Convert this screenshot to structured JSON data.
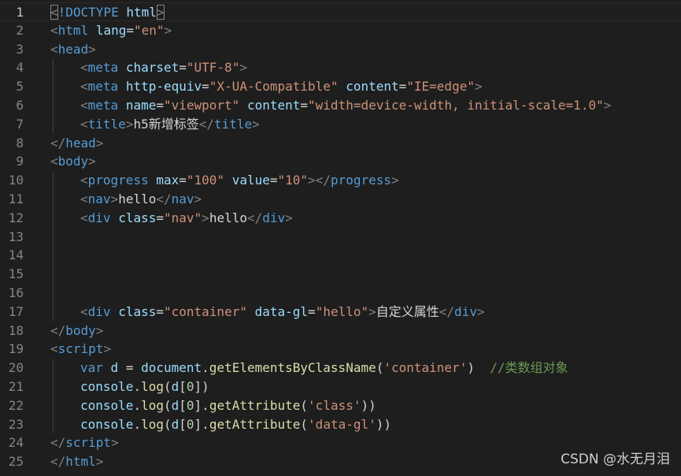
{
  "editor": {
    "lines": [
      {
        "num": "1",
        "indent": 0,
        "tokens": [
          {
            "t": "<",
            "c": "bracket",
            "m": 1
          },
          {
            "t": "!DOCTYPE",
            "c": "tag"
          },
          {
            "t": " ",
            "c": "text"
          },
          {
            "t": "html",
            "c": "attr"
          },
          {
            "t": ">",
            "c": "bracket",
            "m": 1
          }
        ]
      },
      {
        "num": "2",
        "indent": 0,
        "tokens": [
          {
            "t": "<",
            "c": "bracket"
          },
          {
            "t": "html",
            "c": "tag"
          },
          {
            "t": " ",
            "c": "text"
          },
          {
            "t": "lang",
            "c": "attr"
          },
          {
            "t": "=",
            "c": "punct"
          },
          {
            "t": "\"en\"",
            "c": "str"
          },
          {
            "t": ">",
            "c": "bracket"
          }
        ]
      },
      {
        "num": "3",
        "indent": 0,
        "tokens": [
          {
            "t": "<",
            "c": "bracket"
          },
          {
            "t": "head",
            "c": "tag"
          },
          {
            "t": ">",
            "c": "bracket"
          }
        ]
      },
      {
        "num": "4",
        "indent": 1,
        "tokens": [
          {
            "t": "<",
            "c": "bracket"
          },
          {
            "t": "meta",
            "c": "tag"
          },
          {
            "t": " ",
            "c": "text"
          },
          {
            "t": "charset",
            "c": "attr"
          },
          {
            "t": "=",
            "c": "punct"
          },
          {
            "t": "\"UTF-8\"",
            "c": "str"
          },
          {
            "t": ">",
            "c": "bracket"
          }
        ]
      },
      {
        "num": "5",
        "indent": 1,
        "tokens": [
          {
            "t": "<",
            "c": "bracket"
          },
          {
            "t": "meta",
            "c": "tag"
          },
          {
            "t": " ",
            "c": "text"
          },
          {
            "t": "http-equiv",
            "c": "attr"
          },
          {
            "t": "=",
            "c": "punct"
          },
          {
            "t": "\"X-UA-Compatible\"",
            "c": "str"
          },
          {
            "t": " ",
            "c": "text"
          },
          {
            "t": "content",
            "c": "attr"
          },
          {
            "t": "=",
            "c": "punct"
          },
          {
            "t": "\"IE=edge\"",
            "c": "str"
          },
          {
            "t": ">",
            "c": "bracket"
          }
        ]
      },
      {
        "num": "6",
        "indent": 1,
        "tokens": [
          {
            "t": "<",
            "c": "bracket"
          },
          {
            "t": "meta",
            "c": "tag"
          },
          {
            "t": " ",
            "c": "text"
          },
          {
            "t": "name",
            "c": "attr"
          },
          {
            "t": "=",
            "c": "punct"
          },
          {
            "t": "\"viewport\"",
            "c": "str"
          },
          {
            "t": " ",
            "c": "text"
          },
          {
            "t": "content",
            "c": "attr"
          },
          {
            "t": "=",
            "c": "punct"
          },
          {
            "t": "\"width=device-width, initial-scale=1.0\"",
            "c": "str"
          },
          {
            "t": ">",
            "c": "bracket"
          }
        ]
      },
      {
        "num": "7",
        "indent": 1,
        "tokens": [
          {
            "t": "<",
            "c": "bracket"
          },
          {
            "t": "title",
            "c": "tag"
          },
          {
            "t": ">",
            "c": "bracket"
          },
          {
            "t": "h5新增标签",
            "c": "text"
          },
          {
            "t": "</",
            "c": "bracket"
          },
          {
            "t": "title",
            "c": "tag"
          },
          {
            "t": ">",
            "c": "bracket"
          }
        ]
      },
      {
        "num": "8",
        "indent": 0,
        "tokens": [
          {
            "t": "</",
            "c": "bracket"
          },
          {
            "t": "head",
            "c": "tag"
          },
          {
            "t": ">",
            "c": "bracket"
          }
        ]
      },
      {
        "num": "9",
        "indent": 0,
        "tokens": [
          {
            "t": "<",
            "c": "bracket"
          },
          {
            "t": "body",
            "c": "tag"
          },
          {
            "t": ">",
            "c": "bracket"
          }
        ]
      },
      {
        "num": "10",
        "indent": 1,
        "tokens": [
          {
            "t": "<",
            "c": "bracket"
          },
          {
            "t": "progress",
            "c": "tag"
          },
          {
            "t": " ",
            "c": "text"
          },
          {
            "t": "max",
            "c": "attr"
          },
          {
            "t": "=",
            "c": "punct"
          },
          {
            "t": "\"100\"",
            "c": "str"
          },
          {
            "t": " ",
            "c": "text"
          },
          {
            "t": "value",
            "c": "attr"
          },
          {
            "t": "=",
            "c": "punct"
          },
          {
            "t": "\"10\"",
            "c": "str"
          },
          {
            "t": "></",
            "c": "bracket"
          },
          {
            "t": "progress",
            "c": "tag"
          },
          {
            "t": ">",
            "c": "bracket"
          }
        ]
      },
      {
        "num": "11",
        "indent": 1,
        "tokens": [
          {
            "t": "<",
            "c": "bracket"
          },
          {
            "t": "nav",
            "c": "tag"
          },
          {
            "t": ">",
            "c": "bracket"
          },
          {
            "t": "hello",
            "c": "text"
          },
          {
            "t": "</",
            "c": "bracket"
          },
          {
            "t": "nav",
            "c": "tag"
          },
          {
            "t": ">",
            "c": "bracket"
          }
        ]
      },
      {
        "num": "12",
        "indent": 1,
        "tokens": [
          {
            "t": "<",
            "c": "bracket"
          },
          {
            "t": "div",
            "c": "tag"
          },
          {
            "t": " ",
            "c": "text"
          },
          {
            "t": "class",
            "c": "attr"
          },
          {
            "t": "=",
            "c": "punct"
          },
          {
            "t": "\"nav\"",
            "c": "str"
          },
          {
            "t": ">",
            "c": "bracket"
          },
          {
            "t": "hello",
            "c": "text"
          },
          {
            "t": "</",
            "c": "bracket"
          },
          {
            "t": "div",
            "c": "tag"
          },
          {
            "t": ">",
            "c": "bracket"
          }
        ]
      },
      {
        "num": "13",
        "indent": 1,
        "tokens": []
      },
      {
        "num": "14",
        "indent": 1,
        "tokens": []
      },
      {
        "num": "15",
        "indent": 1,
        "tokens": []
      },
      {
        "num": "16",
        "indent": 1,
        "tokens": []
      },
      {
        "num": "17",
        "indent": 1,
        "tokens": [
          {
            "t": "<",
            "c": "bracket"
          },
          {
            "t": "div",
            "c": "tag"
          },
          {
            "t": " ",
            "c": "text"
          },
          {
            "t": "class",
            "c": "attr"
          },
          {
            "t": "=",
            "c": "punct"
          },
          {
            "t": "\"container\"",
            "c": "str"
          },
          {
            "t": " ",
            "c": "text"
          },
          {
            "t": "data-gl",
            "c": "attr"
          },
          {
            "t": "=",
            "c": "punct"
          },
          {
            "t": "\"hello\"",
            "c": "str"
          },
          {
            "t": ">",
            "c": "bracket"
          },
          {
            "t": "自定义属性",
            "c": "text"
          },
          {
            "t": "</",
            "c": "bracket"
          },
          {
            "t": "div",
            "c": "tag"
          },
          {
            "t": ">",
            "c": "bracket"
          }
        ]
      },
      {
        "num": "18",
        "indent": 0,
        "tokens": [
          {
            "t": "</",
            "c": "bracket"
          },
          {
            "t": "body",
            "c": "tag"
          },
          {
            "t": ">",
            "c": "bracket"
          }
        ]
      },
      {
        "num": "19",
        "indent": 0,
        "tokens": [
          {
            "t": "<",
            "c": "bracket"
          },
          {
            "t": "script",
            "c": "tag"
          },
          {
            "t": ">",
            "c": "bracket"
          }
        ]
      },
      {
        "num": "20",
        "indent": 1,
        "tokens": [
          {
            "t": "var",
            "c": "kw"
          },
          {
            "t": " ",
            "c": "text"
          },
          {
            "t": "d",
            "c": "var"
          },
          {
            "t": " = ",
            "c": "punct"
          },
          {
            "t": "document",
            "c": "var"
          },
          {
            "t": ".",
            "c": "punct"
          },
          {
            "t": "getElementsByClassName",
            "c": "func"
          },
          {
            "t": "(",
            "c": "punct"
          },
          {
            "t": "'container'",
            "c": "str"
          },
          {
            "t": ")  ",
            "c": "punct"
          },
          {
            "t": "//类数组对象",
            "c": "comment"
          }
        ]
      },
      {
        "num": "21",
        "indent": 1,
        "tokens": [
          {
            "t": "console",
            "c": "var"
          },
          {
            "t": ".",
            "c": "punct"
          },
          {
            "t": "log",
            "c": "func"
          },
          {
            "t": "(",
            "c": "punct"
          },
          {
            "t": "d",
            "c": "var"
          },
          {
            "t": "[",
            "c": "punct"
          },
          {
            "t": "0",
            "c": "num"
          },
          {
            "t": "])",
            "c": "punct"
          }
        ]
      },
      {
        "num": "22",
        "indent": 1,
        "tokens": [
          {
            "t": "console",
            "c": "var"
          },
          {
            "t": ".",
            "c": "punct"
          },
          {
            "t": "log",
            "c": "func"
          },
          {
            "t": "(",
            "c": "punct"
          },
          {
            "t": "d",
            "c": "var"
          },
          {
            "t": "[",
            "c": "punct"
          },
          {
            "t": "0",
            "c": "num"
          },
          {
            "t": "].",
            "c": "punct"
          },
          {
            "t": "getAttribute",
            "c": "func"
          },
          {
            "t": "(",
            "c": "punct"
          },
          {
            "t": "'class'",
            "c": "str"
          },
          {
            "t": "))",
            "c": "punct"
          }
        ]
      },
      {
        "num": "23",
        "indent": 1,
        "tokens": [
          {
            "t": "console",
            "c": "var"
          },
          {
            "t": ".",
            "c": "punct"
          },
          {
            "t": "log",
            "c": "func"
          },
          {
            "t": "(",
            "c": "punct"
          },
          {
            "t": "d",
            "c": "var"
          },
          {
            "t": "[",
            "c": "punct"
          },
          {
            "t": "0",
            "c": "num"
          },
          {
            "t": "].",
            "c": "punct"
          },
          {
            "t": "getAttribute",
            "c": "func"
          },
          {
            "t": "(",
            "c": "punct"
          },
          {
            "t": "'data-gl'",
            "c": "str"
          },
          {
            "t": "))",
            "c": "punct"
          }
        ]
      },
      {
        "num": "24",
        "indent": 0,
        "tokens": [
          {
            "t": "</",
            "c": "bracket"
          },
          {
            "t": "script",
            "c": "tag"
          },
          {
            "t": ">",
            "c": "bracket"
          }
        ]
      },
      {
        "num": "25",
        "indent": 0,
        "tokens": [
          {
            "t": "</",
            "c": "bracket"
          },
          {
            "t": "html",
            "c": "tag"
          },
          {
            "t": ">",
            "c": "bracket"
          }
        ]
      }
    ],
    "current_line": "1"
  },
  "watermark": "CSDN @水无月泪",
  "colors": {
    "background": "#1e1e1e",
    "tag": "#569cd6",
    "attribute": "#9cdcfe",
    "string": "#ce9178",
    "function": "#dcdcaa",
    "comment": "#6a9955",
    "number": "#b5cea8"
  }
}
